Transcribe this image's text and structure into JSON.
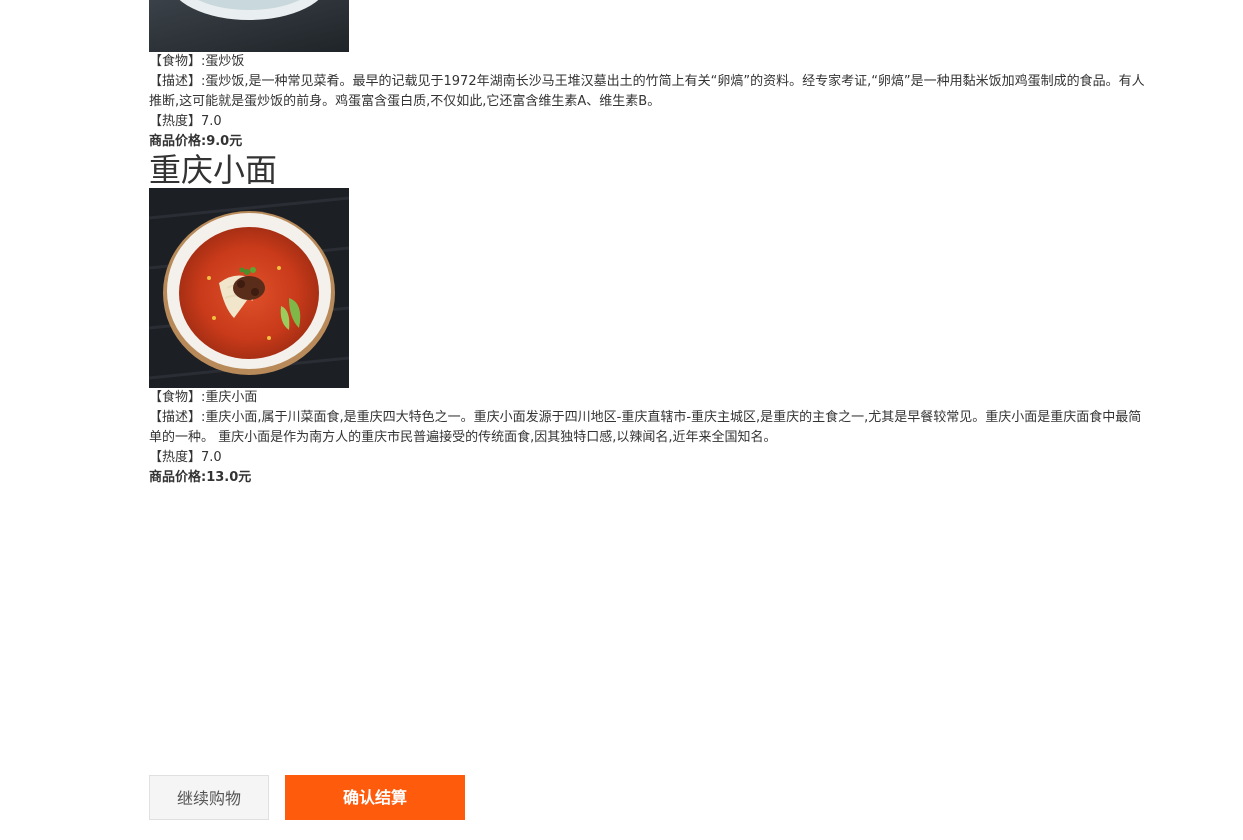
{
  "products": [
    {
      "food_line": "【食物】:蛋炒饭",
      "desc_line": "【描述】:蛋炒饭,是一种常见菜肴。最早的记载见于1972年湖南长沙马王堆汉墓出土的竹简上有关“卵熇”的资料。经专家考证,“卵熇”是一种用黏米饭加鸡蛋制成的食品。有人推断,这可能就是蛋炒饭的前身。鸡蛋富含蛋白质,不仅如此,它还富含维生素A、维生素B。",
      "heat_line": "【热度】7.0",
      "price_line": "商品价格:9.0元"
    },
    {
      "title": "重庆小面",
      "food_line": "【食物】:重庆小面",
      "desc_line": "【描述】:重庆小面,属于川菜面食,是重庆四大特色之一。重庆小面发源于四川地区-重庆直辖市-重庆主城区,是重庆的主食之一,尤其是早餐较常见。重庆小面是重庆面食中最简单的一种。 重庆小面是作为南方人的重庆市民普遍接受的传统面食,因其独特口感,以辣闻名,近年来全国知名。",
      "heat_line": "【热度】7.0",
      "price_line": "商品价格:13.0元"
    }
  ],
  "actions": {
    "continue_label": "继续购物",
    "confirm_label": "确认结算"
  },
  "colors": {
    "confirm_bg": "#ff5b0d",
    "continue_bg": "#f5f5f5"
  }
}
